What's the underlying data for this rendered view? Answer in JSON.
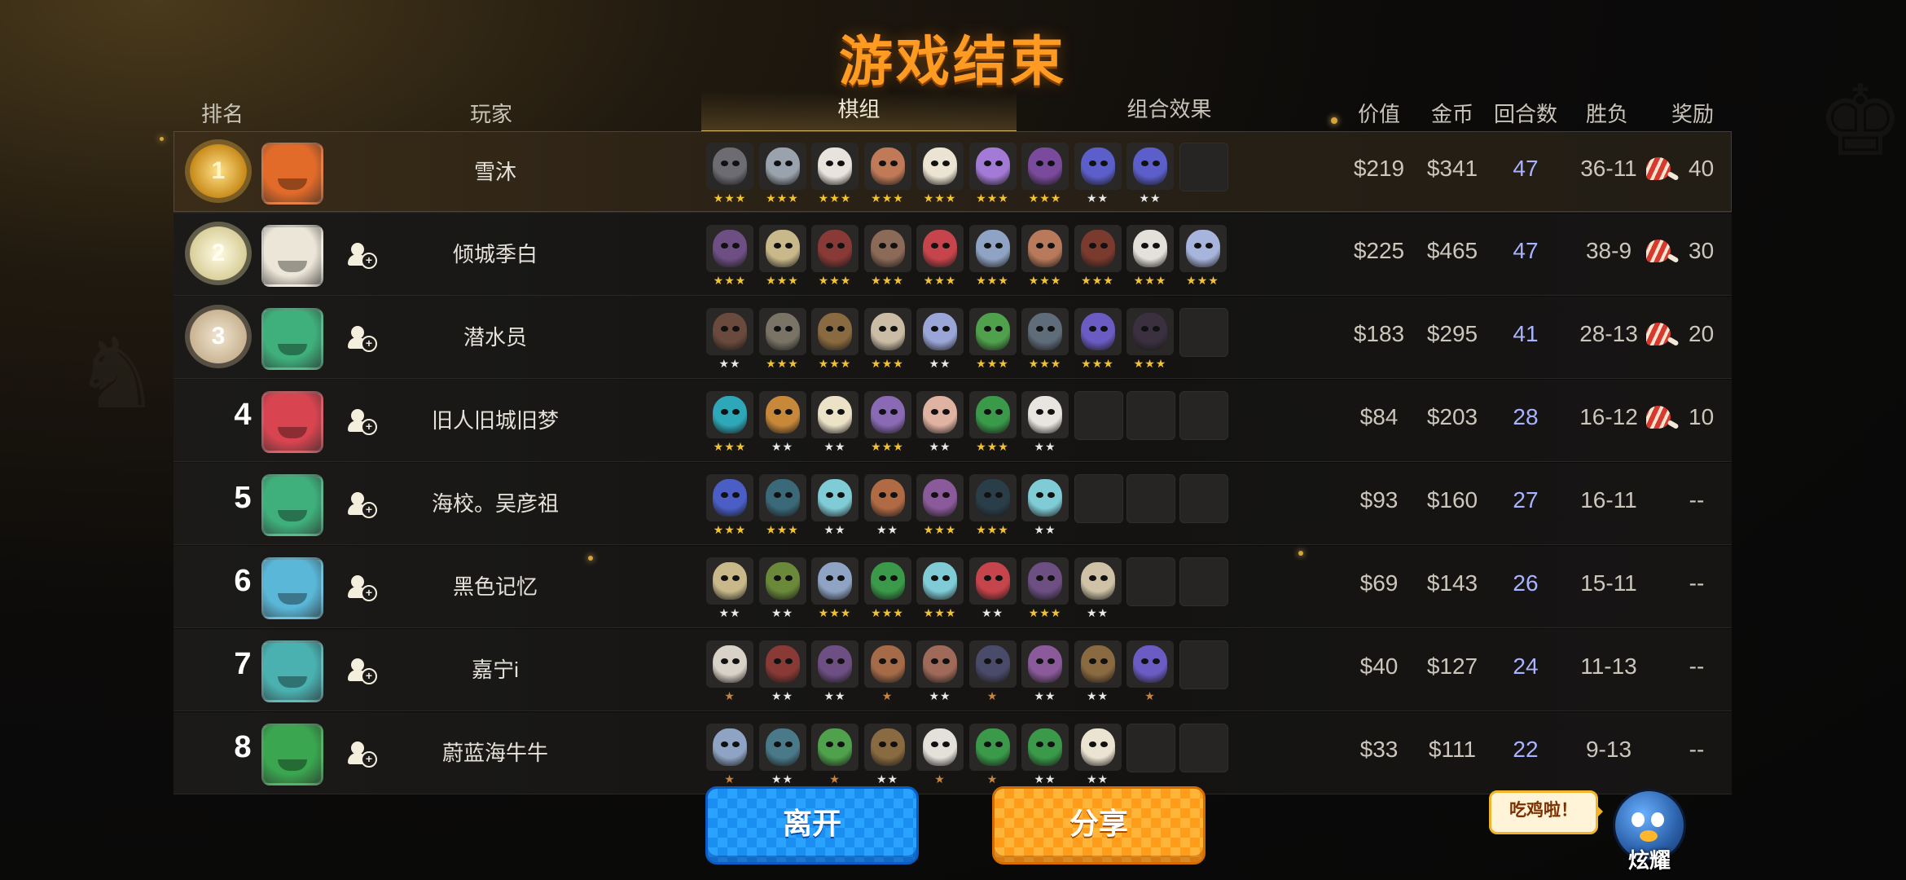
{
  "title": "游戏结束",
  "header": {
    "rank": "排名",
    "player": "玩家",
    "lineup_tab": "棋组",
    "synergy_tab": "组合效果",
    "value": "价值",
    "gold": "金币",
    "rounds": "回合数",
    "winloss": "胜负",
    "reward": "奖励"
  },
  "players": [
    {
      "rank": "1",
      "badge": "gold",
      "name": "雪沐",
      "avatar_color": "#e26b2a",
      "value": "$219",
      "gold": "$341",
      "rounds": "47",
      "winloss": "36-11",
      "reward": "40",
      "add_friend": false,
      "units": [
        {
          "c": "#6d6c73",
          "s": "★★★",
          "t": "g"
        },
        {
          "c": "#9aa3ad",
          "s": "★★★",
          "t": "g"
        },
        {
          "c": "#e8e3dc",
          "s": "★★★",
          "t": "g"
        },
        {
          "c": "#c07a58",
          "s": "★★★",
          "t": "g"
        },
        {
          "c": "#ece4d2",
          "s": "★★★",
          "t": "g"
        },
        {
          "c": "#a37bd6",
          "s": "★★★",
          "t": "g"
        },
        {
          "c": "#7a4b9c",
          "s": "★★★",
          "t": "g"
        },
        {
          "c": "#5c5fc9",
          "s": "★★",
          "t": "s"
        },
        {
          "c": "#5c5fc9",
          "s": "★★",
          "t": "s"
        },
        {
          "c": "",
          "s": "",
          "t": "s"
        }
      ]
    },
    {
      "rank": "2",
      "badge": "silver",
      "name": "倾城季白",
      "avatar_color": "#ece6d8",
      "value": "$225",
      "gold": "$465",
      "rounds": "47",
      "winloss": "38-9",
      "reward": "30",
      "add_friend": true,
      "units": [
        {
          "c": "#6d4f84",
          "s": "★★★",
          "t": "g"
        },
        {
          "c": "#c9b98a",
          "s": "★★★",
          "t": "g"
        },
        {
          "c": "#8a3a36",
          "s": "★★★",
          "t": "g"
        },
        {
          "c": "#8c6a58",
          "s": "★★★",
          "t": "g"
        },
        {
          "c": "#c6444b",
          "s": "★★★",
          "t": "g"
        },
        {
          "c": "#8fa4c4",
          "s": "★★★",
          "t": "g"
        },
        {
          "c": "#b87a5a",
          "s": "★★★",
          "t": "g"
        },
        {
          "c": "#7a3a2e",
          "s": "★★★",
          "t": "g"
        },
        {
          "c": "#e4e0da",
          "s": "★★★",
          "t": "g"
        },
        {
          "c": "#a7b4dc",
          "s": "★★★",
          "t": "g"
        }
      ]
    },
    {
      "rank": "3",
      "badge": "bronze",
      "name": "潜水员",
      "avatar_color": "#3fb07c",
      "value": "$183",
      "gold": "$295",
      "rounds": "41",
      "winloss": "28-13",
      "reward": "20",
      "add_friend": true,
      "units": [
        {
          "c": "#6a4a3c",
          "s": "★★",
          "t": "s"
        },
        {
          "c": "#7a7466",
          "s": "★★★",
          "t": "g"
        },
        {
          "c": "#8a6a40",
          "s": "★★★",
          "t": "g"
        },
        {
          "c": "#cbbca6",
          "s": "★★★",
          "t": "g"
        },
        {
          "c": "#9aa6d8",
          "s": "★★",
          "t": "s"
        },
        {
          "c": "#4fa14c",
          "s": "★★★",
          "t": "g"
        },
        {
          "c": "#5f6c7a",
          "s": "★★★",
          "t": "g"
        },
        {
          "c": "#6a5cc2",
          "s": "★★★",
          "t": "g"
        },
        {
          "c": "#3a3040",
          "s": "★★★",
          "t": "g"
        },
        {
          "c": "",
          "s": "",
          "t": "s"
        }
      ]
    },
    {
      "rank": "4",
      "badge": "",
      "name": "旧人旧城旧梦",
      "avatar_color": "#d84550",
      "value": "$84",
      "gold": "$203",
      "rounds": "28",
      "winloss": "16-12",
      "reward": "10",
      "add_friend": true,
      "units": [
        {
          "c": "#2ea7b8",
          "s": "★★★",
          "t": "g"
        },
        {
          "c": "#c7883a",
          "s": "★★",
          "t": "s"
        },
        {
          "c": "#ece2c8",
          "s": "★★",
          "t": "s"
        },
        {
          "c": "#8a6ab4",
          "s": "★★★",
          "t": "g"
        },
        {
          "c": "#e0b2a2",
          "s": "★★",
          "t": "s"
        },
        {
          "c": "#3a9a4a",
          "s": "★★★",
          "t": "g"
        },
        {
          "c": "#e8e4e0",
          "s": "★★",
          "t": "s"
        },
        {
          "c": "",
          "s": "",
          "t": "s"
        },
        {
          "c": "",
          "s": "",
          "t": "s"
        },
        {
          "c": "",
          "s": "",
          "t": "s"
        }
      ]
    },
    {
      "rank": "5",
      "badge": "",
      "name": "海校。吴彦祖",
      "avatar_color": "#3fb07c",
      "value": "$93",
      "gold": "$160",
      "rounds": "27",
      "winloss": "16-11",
      "reward": "--",
      "add_friend": true,
      "units": [
        {
          "c": "#4a5ec6",
          "s": "★★★",
          "t": "g"
        },
        {
          "c": "#3a6a7a",
          "s": "★★★",
          "t": "g"
        },
        {
          "c": "#7fcbd6",
          "s": "★★",
          "t": "s"
        },
        {
          "c": "#b06a44",
          "s": "★★",
          "t": "s"
        },
        {
          "c": "#8a5a9a",
          "s": "★★★",
          "t": "g"
        },
        {
          "c": "#2a3e4a",
          "s": "★★★",
          "t": "g"
        },
        {
          "c": "#7fcbd6",
          "s": "★★",
          "t": "s"
        },
        {
          "c": "",
          "s": "",
          "t": "s"
        },
        {
          "c": "",
          "s": "",
          "t": "s"
        },
        {
          "c": "",
          "s": "",
          "t": "s"
        }
      ]
    },
    {
      "rank": "6",
      "badge": "",
      "name": "黑色记忆",
      "avatar_color": "#5ab7d8",
      "value": "$69",
      "gold": "$143",
      "rounds": "26",
      "winloss": "15-11",
      "reward": "--",
      "add_friend": true,
      "units": [
        {
          "c": "#c9b98a",
          "s": "★★",
          "t": "s"
        },
        {
          "c": "#6a8a3a",
          "s": "★★",
          "t": "s"
        },
        {
          "c": "#8fa4c4",
          "s": "★★★",
          "t": "g"
        },
        {
          "c": "#3a9a4a",
          "s": "★★★",
          "t": "g"
        },
        {
          "c": "#7fcbd6",
          "s": "★★★",
          "t": "g"
        },
        {
          "c": "#c6444b",
          "s": "★★",
          "t": "s"
        },
        {
          "c": "#6d4f84",
          "s": "★★★",
          "t": "g"
        },
        {
          "c": "#cfc2a6",
          "s": "★★",
          "t": "s"
        },
        {
          "c": "",
          "s": "",
          "t": "s"
        },
        {
          "c": "",
          "s": "",
          "t": "s"
        }
      ]
    },
    {
      "rank": "7",
      "badge": "",
      "name": "嘉宁i",
      "avatar_color": "#4ab0b0",
      "value": "$40",
      "gold": "$127",
      "rounds": "24",
      "winloss": "11-13",
      "reward": "--",
      "add_friend": true,
      "units": [
        {
          "c": "#d8d2c8",
          "s": "★",
          "t": "b"
        },
        {
          "c": "#8a3a36",
          "s": "★★",
          "t": "s"
        },
        {
          "c": "#6d4f84",
          "s": "★★",
          "t": "s"
        },
        {
          "c": "#a56a48",
          "s": "★",
          "t": "b"
        },
        {
          "c": "#a06a5a",
          "s": "★★",
          "t": "s"
        },
        {
          "c": "#4a4a6a",
          "s": "★",
          "t": "b"
        },
        {
          "c": "#8a5a9a",
          "s": "★★",
          "t": "s"
        },
        {
          "c": "#8a6a40",
          "s": "★★",
          "t": "s"
        },
        {
          "c": "#6a5cc2",
          "s": "★",
          "t": "b"
        },
        {
          "c": "",
          "s": "",
          "t": "s"
        }
      ]
    },
    {
      "rank": "8",
      "badge": "",
      "name": "蔚蓝海牛牛",
      "avatar_color": "#3aa650",
      "value": "$33",
      "gold": "$111",
      "rounds": "22",
      "winloss": "9-13",
      "reward": "--",
      "add_friend": true,
      "units": [
        {
          "c": "#8fa4c4",
          "s": "★",
          "t": "b"
        },
        {
          "c": "#4a7a8a",
          "s": "★★",
          "t": "s"
        },
        {
          "c": "#4fa14c",
          "s": "★",
          "t": "b"
        },
        {
          "c": "#8a6a40",
          "s": "★★",
          "t": "s"
        },
        {
          "c": "#e4e0da",
          "s": "★",
          "t": "b"
        },
        {
          "c": "#3a9a4a",
          "s": "★",
          "t": "b"
        },
        {
          "c": "#3a9a4a",
          "s": "★★",
          "t": "s"
        },
        {
          "c": "#ece4d2",
          "s": "★★",
          "t": "s"
        },
        {
          "c": "",
          "s": "",
          "t": "s"
        },
        {
          "c": "",
          "s": "",
          "t": "s"
        }
      ]
    }
  ],
  "buttons": {
    "leave": "离开",
    "share": "分享"
  },
  "speech": "吃鸡啦！",
  "mascot_label": "炫耀",
  "colors": {
    "title": "#ff9a22",
    "rounds": "#a9b3ff",
    "leave": "#1b8ef2",
    "share": "#ff9d1a"
  }
}
